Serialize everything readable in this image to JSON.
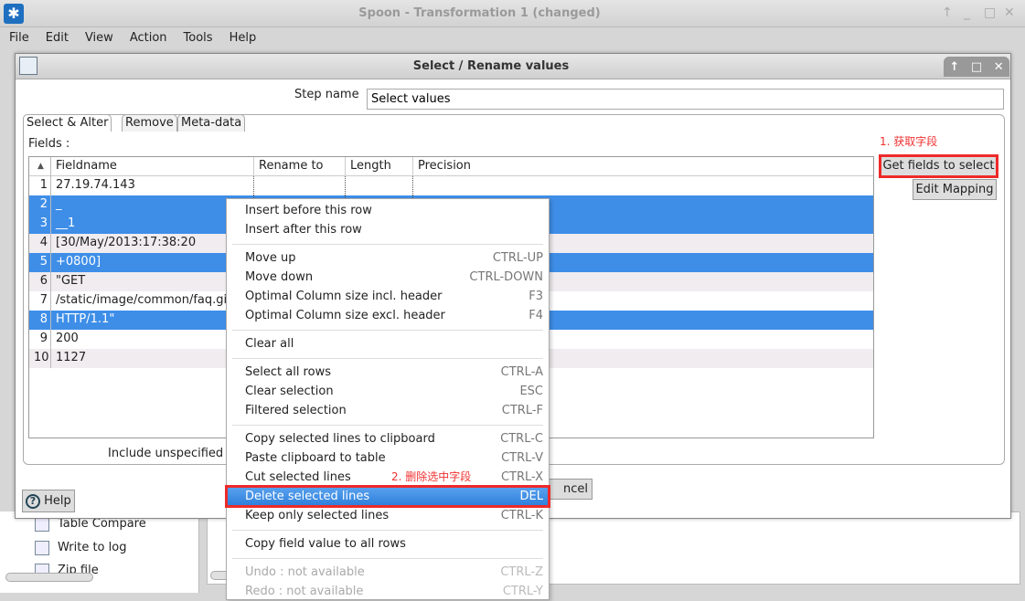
{
  "window": {
    "title": "Spoon - Transformation 1 (changed)",
    "controls": [
      "↑",
      "_",
      "□",
      "✕"
    ]
  },
  "menubar": [
    "File",
    "Edit",
    "View",
    "Action",
    "Tools",
    "Help"
  ],
  "background": {
    "steps": [
      "Table Compare",
      "Write to log",
      "Zip file"
    ]
  },
  "dialog": {
    "title": "Select / Rename values",
    "controls": [
      "↑",
      "□",
      "✕"
    ],
    "step_name_label": "Step name",
    "step_name_value": "Select values",
    "tabs": [
      {
        "label": "Select & Alter",
        "active": true
      },
      {
        "label": "Remove"
      },
      {
        "label": "Meta-data"
      }
    ],
    "fields_label": "Fields :",
    "table": {
      "sort_indicator": "▲",
      "columns": [
        "Fieldname",
        "Rename to",
        "Length",
        "Precision"
      ],
      "rows": [
        {
          "n": "1",
          "fieldname": "27.19.74.143",
          "selected": false
        },
        {
          "n": "2",
          "fieldname": "_",
          "selected": true
        },
        {
          "n": "3",
          "fieldname": "__1",
          "selected": true
        },
        {
          "n": "4",
          "fieldname": "[30/May/2013:17:38:20",
          "selected": false
        },
        {
          "n": "5",
          "fieldname": "+0800]",
          "selected": true
        },
        {
          "n": "6",
          "fieldname": "\"GET",
          "selected": false
        },
        {
          "n": "7",
          "fieldname": "/static/image/common/faq.gif",
          "selected": false
        },
        {
          "n": "8",
          "fieldname": "HTTP/1.1\"",
          "selected": true
        },
        {
          "n": "9",
          "fieldname": "200",
          "selected": false
        },
        {
          "n": "10",
          "fieldname": "1127",
          "selected": false
        }
      ]
    },
    "get_fields_button": "Get fields to select",
    "edit_mapping_button": "Edit Mapping",
    "include_unspecified_label": "Include unspecified",
    "help_button": "Help",
    "cancel_button": "ncel",
    "annotation1": "1. 获取字段",
    "annotation2": "2. 删除选中字段"
  },
  "context_menu": [
    {
      "label": "Insert before this row"
    },
    {
      "label": "Insert after this row"
    },
    {
      "sep": true
    },
    {
      "label": "Move up",
      "shortcut": "CTRL-UP"
    },
    {
      "label": "Move down",
      "shortcut": "CTRL-DOWN"
    },
    {
      "label": "Optimal Column size incl. header",
      "shortcut": "F3"
    },
    {
      "label": "Optimal Column size excl. header",
      "shortcut": "F4"
    },
    {
      "sep": true
    },
    {
      "label": "Clear all"
    },
    {
      "sep": true
    },
    {
      "label": "Select all rows",
      "shortcut": "CTRL-A"
    },
    {
      "label": "Clear selection",
      "shortcut": "ESC"
    },
    {
      "label": "Filtered selection",
      "shortcut": "CTRL-F"
    },
    {
      "sep": true
    },
    {
      "label": "Copy selected lines to clipboard",
      "shortcut": "CTRL-C"
    },
    {
      "label": "Paste clipboard to table",
      "shortcut": "CTRL-V"
    },
    {
      "label": "Cut selected lines",
      "shortcut": "CTRL-X"
    },
    {
      "label": "Delete selected lines",
      "shortcut": "DEL",
      "highlighted": true
    },
    {
      "label": "Keep only selected lines",
      "shortcut": "CTRL-K"
    },
    {
      "sep": true
    },
    {
      "label": "Copy field value to all rows"
    },
    {
      "sep": true
    },
    {
      "label": "Undo : not available",
      "shortcut": "CTRL-Z",
      "disabled": true
    },
    {
      "label": "Redo : not available",
      "shortcut": "CTRL-Y",
      "disabled": true
    }
  ]
}
